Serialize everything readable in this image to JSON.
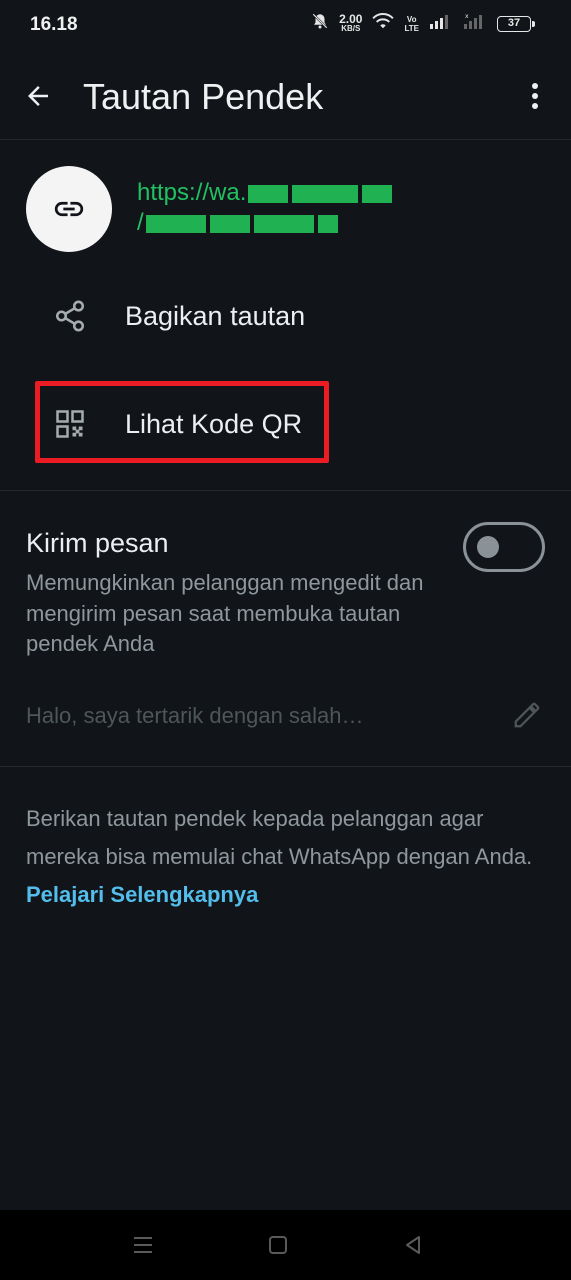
{
  "status_bar": {
    "time": "16.18",
    "net_speed_value": "2.00",
    "net_speed_unit": "KB/S",
    "volte_top": "Vo",
    "volte_bottom": "LTE",
    "battery": "37",
    "icons": [
      "mute-icon",
      "wifi-icon",
      "signal-icon",
      "battery-icon"
    ]
  },
  "app_bar": {
    "title": "Tautan Pendek",
    "icons": [
      "back-arrow-icon",
      "more-vert-icon"
    ]
  },
  "link": {
    "url_prefix": "https://wa.",
    "url_line2_prefix": "/"
  },
  "options": {
    "share_label": "Bagikan tautan",
    "qr_label": "Lihat Kode QR"
  },
  "send_message": {
    "title": "Kirim pesan",
    "description": "Memungkinkan pelanggan mengedit dan mengirim pesan saat membuka tautan pendek Anda",
    "toggle_on": false,
    "message_placeholder": "Halo, saya tertarik dengan salah…"
  },
  "info": {
    "text": "Berikan tautan pendek kepada pelanggan agar mereka bisa memulai chat WhatsApp dengan Anda.",
    "learn_more": "Pelajari Selengkapnya"
  },
  "colors": {
    "background": "#111418",
    "accent_green": "#21c063",
    "link_blue": "#53bdeb",
    "highlight_red": "#ec1c24"
  }
}
